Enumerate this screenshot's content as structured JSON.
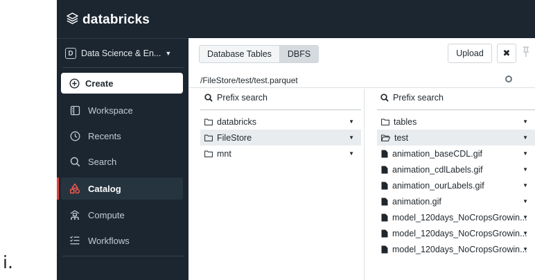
{
  "marker": "i.",
  "brand": {
    "name": "databricks"
  },
  "sidebar": {
    "workspace": {
      "badge": "D",
      "label": "Data Science & En..."
    },
    "create_label": "Create",
    "items": [
      {
        "label": "Workspace",
        "icon": "workspace-icon"
      },
      {
        "label": "Recents",
        "icon": "clock-icon"
      },
      {
        "label": "Search",
        "icon": "search-icon"
      },
      {
        "label": "Catalog",
        "icon": "catalog-icon",
        "active": true
      },
      {
        "label": "Compute",
        "icon": "compute-icon"
      },
      {
        "label": "Workflows",
        "icon": "workflows-icon"
      }
    ]
  },
  "dialog": {
    "tabs": [
      {
        "label": "Database Tables"
      },
      {
        "label": "DBFS",
        "selected": true
      }
    ],
    "upload_label": "Upload",
    "close_label": "✖",
    "path": "/FileStore/test/test.parquet",
    "left_column": {
      "search_placeholder": "Prefix search",
      "items": [
        {
          "name": "databricks",
          "type": "folder"
        },
        {
          "name": "FileStore",
          "type": "folder",
          "selected": true
        },
        {
          "name": "mnt",
          "type": "folder"
        }
      ]
    },
    "right_column": {
      "search_placeholder": "Prefix search",
      "items": [
        {
          "name": "tables",
          "type": "folder"
        },
        {
          "name": "test",
          "type": "folder-open",
          "selected": true
        },
        {
          "name": "animation_baseCDL.gif",
          "type": "file"
        },
        {
          "name": "animation_cdlLabels.gif",
          "type": "file"
        },
        {
          "name": "animation_ourLabels.gif",
          "type": "file"
        },
        {
          "name": "animation.gif",
          "type": "file"
        },
        {
          "name": "model_120days_NoCropsGrowin...",
          "type": "file"
        },
        {
          "name": "model_120days_NoCropsGrowin...",
          "type": "file"
        },
        {
          "name": "model_120days_NoCropsGrowin...",
          "type": "file"
        }
      ]
    }
  },
  "colors": {
    "nav_bg": "#1b2631",
    "accent": "#e0443c",
    "selected_row": "#e9ecee"
  }
}
